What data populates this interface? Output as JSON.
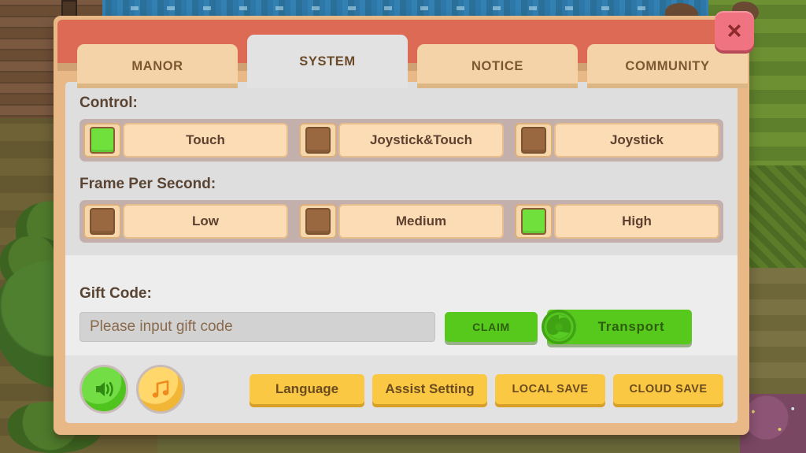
{
  "window": {
    "close_icon": "close-x-icon"
  },
  "tabs": [
    {
      "label": "MANOR",
      "active": false
    },
    {
      "label": "SYSTEM",
      "active": true
    },
    {
      "label": "NOTICE",
      "active": false
    },
    {
      "label": "COMMUNITY",
      "active": false
    }
  ],
  "sections": [
    {
      "label": "Control:",
      "options": [
        {
          "label": "Touch",
          "selected": true
        },
        {
          "label": "Joystick&Touch",
          "selected": false
        },
        {
          "label": "Joystick",
          "selected": false
        }
      ]
    },
    {
      "label": "Frame Per Second:",
      "options": [
        {
          "label": "Low",
          "selected": false
        },
        {
          "label": "Medium",
          "selected": false
        },
        {
          "label": "High",
          "selected": true
        }
      ]
    }
  ],
  "gift_code": {
    "label": "Gift Code:",
    "value": "",
    "placeholder": "Please input gift code",
    "claim_label": "CLAIM",
    "transport_label": "Transport",
    "transport_icon": "portal-swirl-icon"
  },
  "bottom_bar": {
    "sound_icon": "speaker-icon",
    "music_icon": "music-note-icon",
    "buttons": [
      {
        "label": "Language"
      },
      {
        "label": "Assist Setting"
      },
      {
        "label": "LOCAL SAVE"
      },
      {
        "label": "CLOUD SAVE"
      }
    ]
  },
  "colors": {
    "frame": "#e8b887",
    "topbar": "#dd6a55",
    "tab_inactive": "#f3d3a7",
    "tab_active": "#e2e2e2",
    "selected_check": "#6fe03c",
    "unselected_check": "#9a6840",
    "green_button": "#56c91c",
    "yellow_button": "#fbc844",
    "close_button": "#ef7381"
  }
}
